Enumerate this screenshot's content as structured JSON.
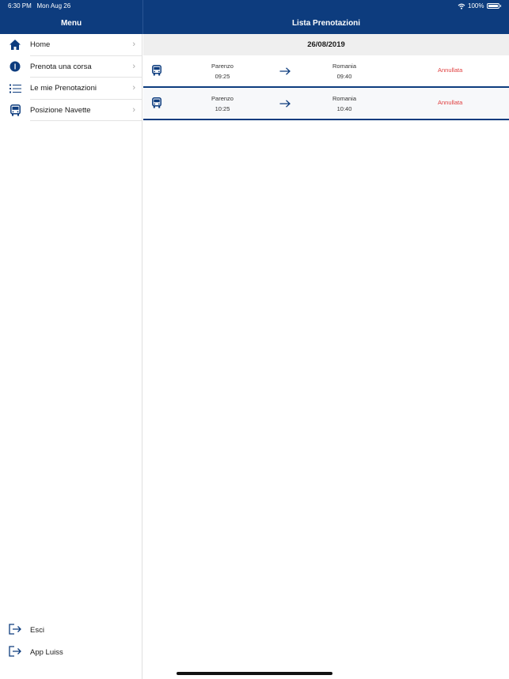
{
  "status_bar": {
    "time": "6:30 PM",
    "date": "Mon Aug 26",
    "battery": "100%"
  },
  "sidebar": {
    "title": "Menu",
    "items": [
      {
        "label": "Home",
        "icon": "home-icon"
      },
      {
        "label": "Prenota una corsa",
        "icon": "info-circle-icon"
      },
      {
        "label": "Le mie Prenotazioni",
        "icon": "list-icon"
      },
      {
        "label": "Posizione Navette",
        "icon": "bus-icon"
      }
    ],
    "bottom_items": [
      {
        "label": "Esci",
        "icon": "logout-icon"
      },
      {
        "label": "App Luiss",
        "icon": "exit-app-icon"
      }
    ]
  },
  "main": {
    "title": "Lista Prenotazioni",
    "date": "26/08/2019",
    "bookings": [
      {
        "from": "Parenzo",
        "departure": "09:25",
        "to": "Romania",
        "arrival": "09:40",
        "status": "Annullata"
      },
      {
        "from": "Parenzo",
        "departure": "10:25",
        "to": "Romania",
        "arrival": "10:40",
        "status": "Annullata"
      }
    ]
  },
  "colors": {
    "primary": "#0d3c7e",
    "cancelled": "#e04040",
    "header_bg": "#efefef"
  }
}
